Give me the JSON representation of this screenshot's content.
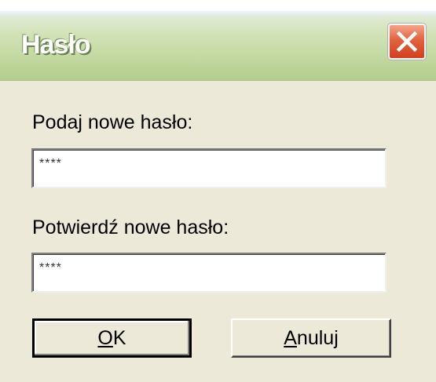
{
  "window": {
    "title": "Hasło"
  },
  "form": {
    "new_password_label": "Podaj nowe hasło:",
    "new_password_value": "****",
    "confirm_password_label": "Potwierdź nowe hasło:",
    "confirm_password_value": "****"
  },
  "buttons": {
    "ok_access_key": "O",
    "ok_rest": "K",
    "cancel_access_key": "A",
    "cancel_rest": "nuluj"
  },
  "icons": {
    "close": "close-icon"
  },
  "colors": {
    "titlebar": "#c2d79f",
    "close_button": "#e0623f",
    "dialog_background": "#ece9d8"
  }
}
